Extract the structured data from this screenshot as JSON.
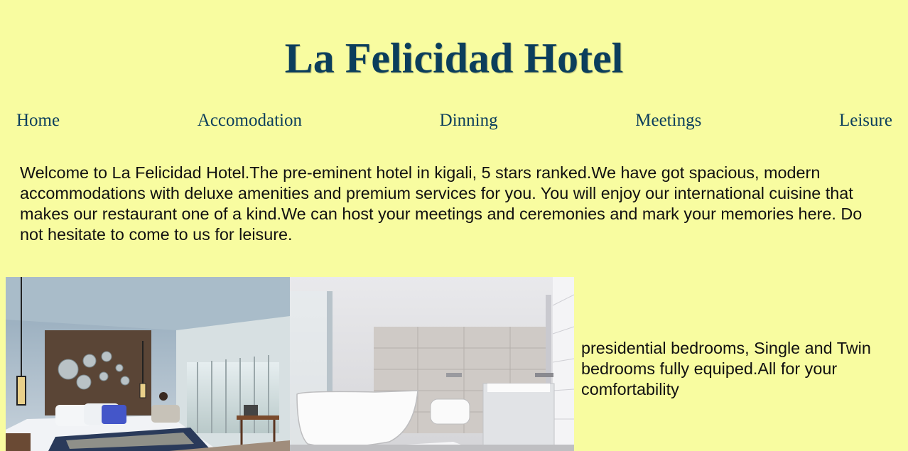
{
  "header": {
    "title": "La Felicidad Hotel"
  },
  "nav": {
    "items": [
      {
        "label": "Home"
      },
      {
        "label": "Accomodation"
      },
      {
        "label": "Dinning"
      },
      {
        "label": "Meetings"
      },
      {
        "label": "Leisure"
      }
    ]
  },
  "main": {
    "intro": "Welcome to La Felicidad Hotel.The pre-eminent hotel in kigali, 5 stars ranked.We have got spacious, modern accommodations with deluxe amenities and premium services for you. You will enjoy our international cuisine that makes our restaurant one of a kind.We can host your meetings and ceremonies and mark your memories here. Do not hesitate to come to us for leisure.",
    "accommodation_caption": "presidential bedrooms, Single and Twin bedrooms fully equiped.All for your comfortability"
  },
  "colors": {
    "background": "#f8fca0",
    "heading": "#0b3e5c",
    "text": "#111111"
  }
}
